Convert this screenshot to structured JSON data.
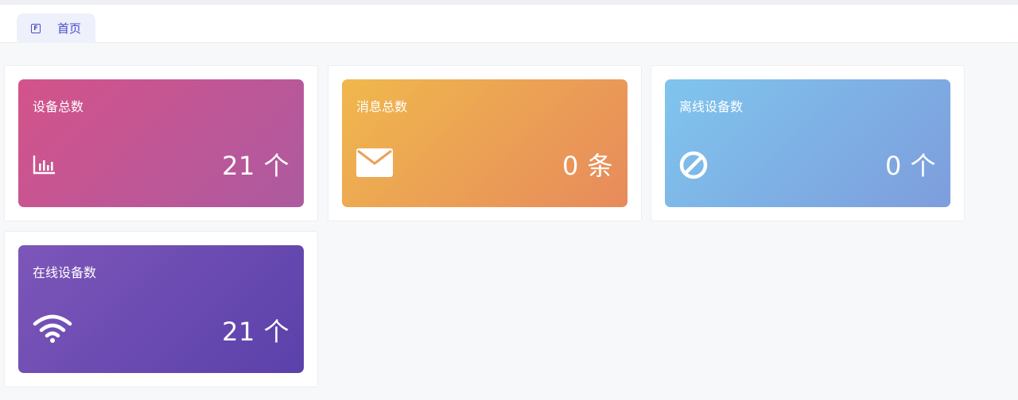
{
  "tabs": [
    {
      "label": "首页",
      "icon": "home-icon"
    }
  ],
  "cards": [
    {
      "title": "设备总数",
      "value": "21 个",
      "icon": "bar-chart-icon",
      "gradient": [
        "#d4538a",
        "#ad5aa0"
      ]
    },
    {
      "title": "消息总数",
      "value": "0 条",
      "icon": "mail-icon",
      "gradient": [
        "#f0b84d",
        "#e78a5c"
      ]
    },
    {
      "title": "离线设备数",
      "value": "0 个",
      "icon": "ban-icon",
      "gradient": [
        "#7fc5ee",
        "#7e9ddc"
      ]
    },
    {
      "title": "在线设备数",
      "value": "21 个",
      "icon": "wifi-icon",
      "gradient": [
        "#7d56b9",
        "#5a41aa"
      ]
    }
  ],
  "colors": {
    "accent": "#4a4ad0",
    "background": "#f7f8fa"
  }
}
